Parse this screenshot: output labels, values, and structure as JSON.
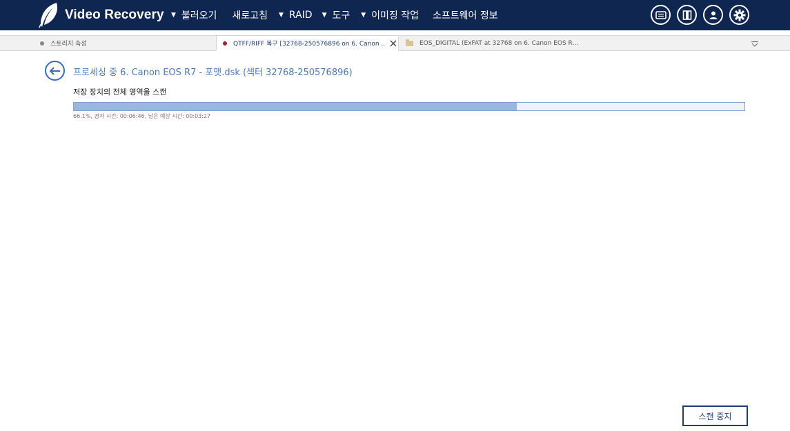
{
  "header": {
    "app_title": "Video Recovery",
    "menu": [
      {
        "label": "불러오기",
        "caret": "▼"
      },
      {
        "label": "새로고침",
        "caret": ""
      },
      {
        "label": "RAID",
        "caret": "▼"
      },
      {
        "label": "도구",
        "caret": "▼"
      },
      {
        "label": "이미징 작업",
        "caret": "▼"
      },
      {
        "label": "소프트웨어 정보",
        "caret": ""
      }
    ],
    "icons": [
      "log-icon",
      "panel-icon",
      "user-icon",
      "gear-icon"
    ],
    "bg_color": "#0f2650"
  },
  "tabs": [
    {
      "label": "스토리지 속성",
      "status": "inactive"
    },
    {
      "label": "QTFF/RIFF 복구 [32768-250576896 on 6. Canon ...",
      "status": "active"
    },
    {
      "label": "EOS_DIGITAL (ExFAT at 32768 on 6. Canon EOS R...",
      "status": "inactive"
    }
  ],
  "content": {
    "title": "프로세싱 중 6. Canon EOS R7 - 포맷.dsk (섹터 32768-250576896)",
    "scan_heading": "저장 장치의 전체 영역을 스캔",
    "progress_fraction": 0.661,
    "progress_text": "66.1%, 경과 시간: 00:06:46, 남은 예상 시간: 00:03:27",
    "stop_button": "스캔 중지"
  }
}
